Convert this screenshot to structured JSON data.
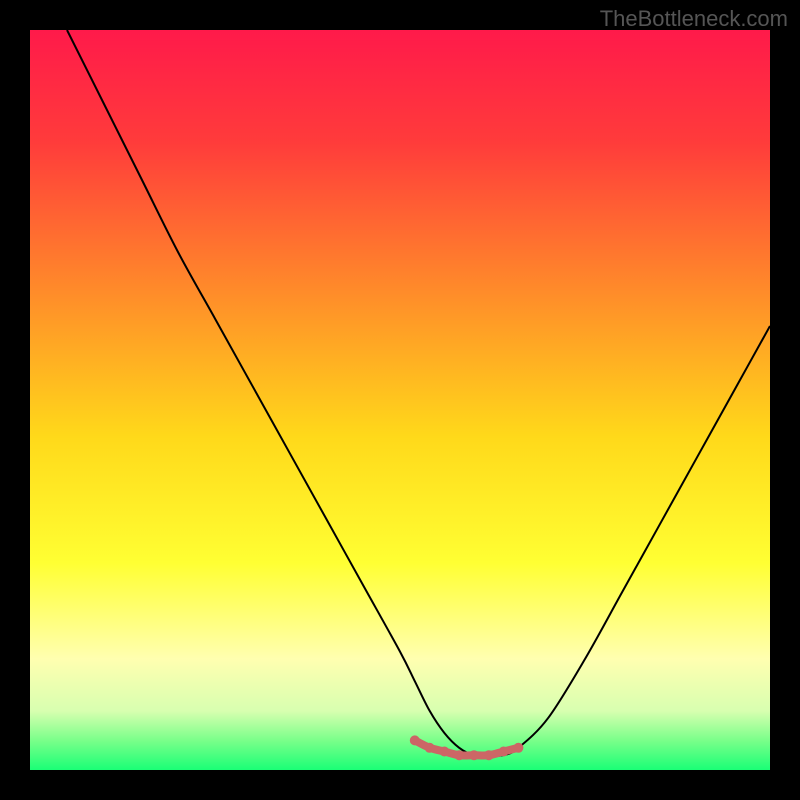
{
  "watermark": "TheBottleneck.com",
  "chart_data": {
    "type": "line",
    "title": "",
    "xlabel": "",
    "ylabel": "",
    "xlim": [
      0,
      100
    ],
    "ylim": [
      0,
      100
    ],
    "gradient_stops": [
      {
        "offset": 0.0,
        "color": "#ff1a4a"
      },
      {
        "offset": 0.15,
        "color": "#ff3b3b"
      },
      {
        "offset": 0.35,
        "color": "#ff8a2a"
      },
      {
        "offset": 0.55,
        "color": "#ffd91a"
      },
      {
        "offset": 0.72,
        "color": "#ffff33"
      },
      {
        "offset": 0.85,
        "color": "#ffffb0"
      },
      {
        "offset": 0.92,
        "color": "#d8ffb0"
      },
      {
        "offset": 0.96,
        "color": "#7aff8a"
      },
      {
        "offset": 1.0,
        "color": "#1aff76"
      }
    ],
    "series": [
      {
        "name": "bottleneck-curve",
        "color": "#000000",
        "x": [
          5,
          10,
          15,
          20,
          25,
          30,
          35,
          40,
          45,
          50,
          52,
          54,
          56,
          58,
          60,
          62,
          64,
          66,
          70,
          75,
          80,
          85,
          90,
          95,
          100
        ],
        "y": [
          100,
          90,
          80,
          70,
          61,
          52,
          43,
          34,
          25,
          16,
          12,
          8,
          5,
          3,
          2,
          2,
          2,
          3,
          7,
          15,
          24,
          33,
          42,
          51,
          60
        ]
      },
      {
        "name": "optimal-zone-marker",
        "color": "#cc6666",
        "x": [
          52,
          54,
          56,
          58,
          60,
          62,
          64,
          66
        ],
        "y": [
          4,
          3,
          2.5,
          2,
          2,
          2,
          2.5,
          3
        ]
      }
    ],
    "optimal_zone": {
      "x_start": 52,
      "x_end": 66
    }
  }
}
